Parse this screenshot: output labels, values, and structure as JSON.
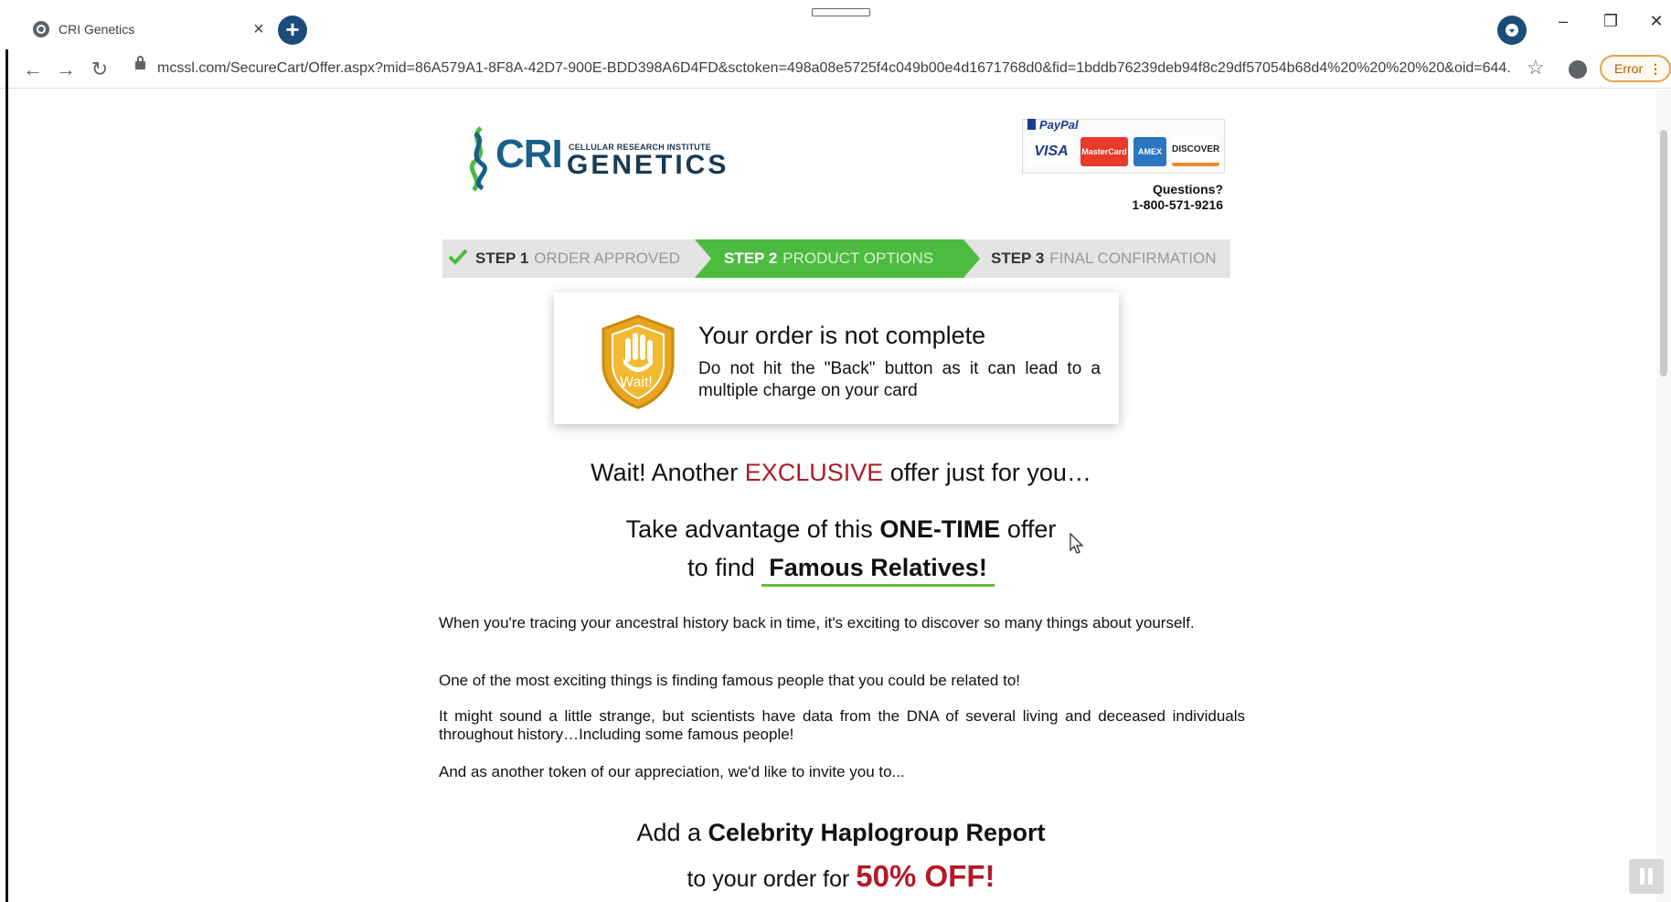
{
  "browser": {
    "tab_title": "CRI Genetics",
    "tab_close": "×",
    "new_tab": "+",
    "url": "mcssl.com/SecureCart/Offer.aspx?mid=86A579A1-8F8A-42D7-900E-BDD398A6D4FD&sctoken=498a08e5725f4c049b00e4d1671768d0&fid=1bddb76239deb94f8c29df57054b68d4%20%20%20%20&oid=644...",
    "error_label": "Error",
    "minimize": "–",
    "restore": "❐",
    "close": "✕",
    "back": "←",
    "forward": "→",
    "reload": "↻",
    "star": "☆"
  },
  "header": {
    "logo_main": "CRI",
    "logo_tag": "CELLULAR RESEARCH INSTITUTE",
    "logo_sub": "GENETICS",
    "paypal": "PayPal",
    "cards": [
      "VISA",
      "MasterCard",
      "AMEX",
      "DISCOVER"
    ],
    "questions_label": "Questions?",
    "phone": "1-800-571-9216"
  },
  "steps": [
    {
      "num": "STEP 1",
      "label": "ORDER APPROVED"
    },
    {
      "num": "STEP 2",
      "label": "PRODUCT OPTIONS"
    },
    {
      "num": "STEP 3",
      "label": "FINAL CONFIRMATION"
    }
  ],
  "warning": {
    "badge": "Wait!",
    "title": "Your order is not complete",
    "text": "Do not hit the \"Back\" button as it can lead to a multiple charge on your card"
  },
  "offer": {
    "wait_pre": "Wait! Another ",
    "wait_highlight": "EXCLUSIVE",
    "wait_post": " offer just for you…",
    "take_pre": "Take advantage of this ",
    "take_bold": "ONE-TIME",
    "take_post": " offer",
    "find_pre": "to find ",
    "find_bold": "Famous Relatives!",
    "paragraphs": [
      "When you're tracing your ancestral history back in time, it's exciting to discover so many things about yourself.",
      "One of the most exciting things is finding famous people that you could be related to!",
      "It might sound a little strange, but scientists have data from the DNA of several living and deceased individuals throughout history…Including some famous people!",
      "And as another token of our appreciation, we'd like to invite you to..."
    ],
    "add_pre": "Add a ",
    "add_bold": "Celebrity Haplogroup Report",
    "off_pre": "to your order for ",
    "off_bold": "50% OFF!"
  },
  "colors": {
    "step_active": "#4cbb3f",
    "accent_red": "#a81d2a",
    "brand_blue": "#1a5f8a"
  }
}
